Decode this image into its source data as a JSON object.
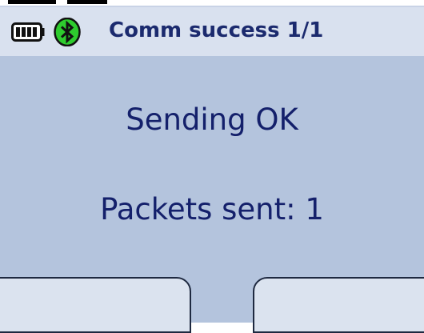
{
  "statusbar": {
    "battery_icon": "battery-icon",
    "bluetooth_icon": "bluetooth-icon",
    "bluetooth_color": "#2ecc2e",
    "text": "Comm success 1/1"
  },
  "main": {
    "line1": "Sending OK",
    "line2": "Packets sent: 1"
  },
  "softkeys": {
    "left_label": "",
    "right_label": ""
  },
  "colors": {
    "screen_bg": "#b4c4dd",
    "statusbar_bg": "#d9e1ef",
    "text": "#14206b"
  }
}
